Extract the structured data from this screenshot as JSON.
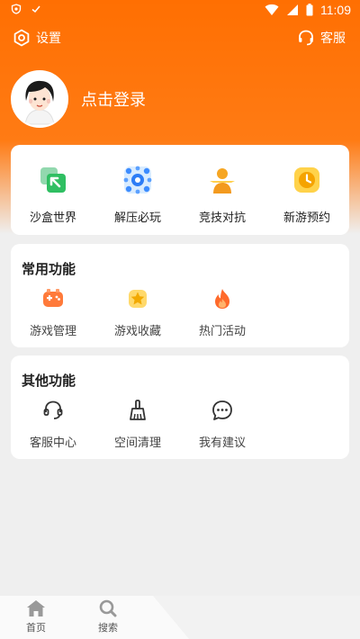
{
  "status": {
    "time": "11:09"
  },
  "topbar": {
    "settings_label": "设置",
    "service_label": "客服"
  },
  "profile": {
    "login_text": "点击登录"
  },
  "quick": [
    {
      "label": "沙盒世界",
      "icon": "sandbox-icon"
    },
    {
      "label": "解压必玩",
      "icon": "decompress-icon"
    },
    {
      "label": "竞技对抗",
      "icon": "competitive-icon"
    },
    {
      "label": "新游预约",
      "icon": "reservation-icon"
    }
  ],
  "common": {
    "title": "常用功能",
    "items": [
      {
        "label": "游戏管理",
        "icon": "gamepad-icon"
      },
      {
        "label": "游戏收藏",
        "icon": "star-icon"
      },
      {
        "label": "热门活动",
        "icon": "fire-icon"
      }
    ]
  },
  "other": {
    "title": "其他功能",
    "items": [
      {
        "label": "客服中心",
        "icon": "headset-icon"
      },
      {
        "label": "空间清理",
        "icon": "broom-icon"
      },
      {
        "label": "我有建议",
        "icon": "chat-icon"
      }
    ]
  },
  "nav": {
    "home": "首页",
    "search": "搜索"
  },
  "colors": {
    "accent": "#ff6f02",
    "card": "#ffffff",
    "background": "#efefef"
  }
}
